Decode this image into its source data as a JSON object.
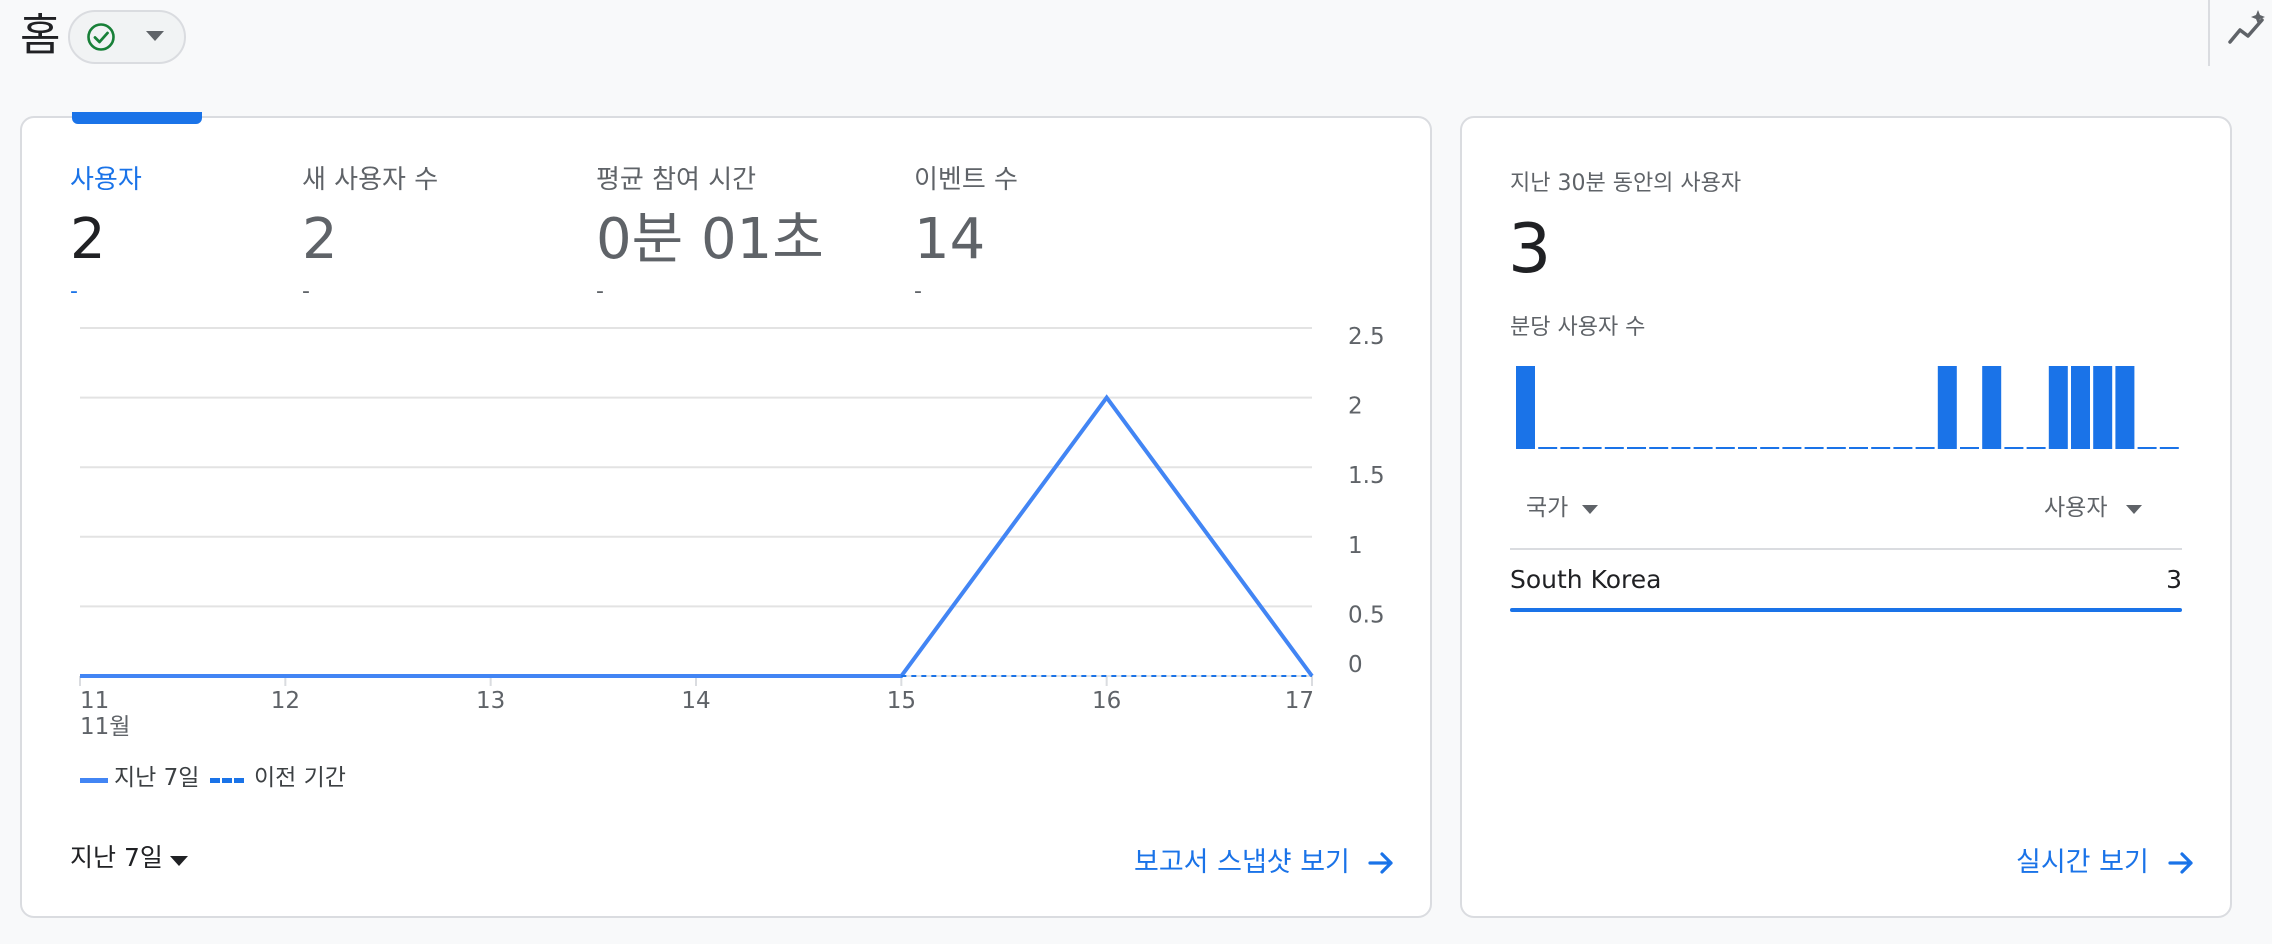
{
  "header": {
    "title": "홈",
    "status_icon": "check-circle-icon",
    "right_icon": "insights-icon"
  },
  "colors": {
    "accent": "#1a73e8",
    "line": "#4285f4",
    "status_green": "#188038"
  },
  "metrics": [
    {
      "label": "사용자",
      "value": "2",
      "delta": "-",
      "active": true
    },
    {
      "label": "새 사용자 수",
      "value": "2",
      "delta": "-",
      "active": false
    },
    {
      "label": "평균 참여 시간",
      "value": "0분 01초",
      "delta": "-",
      "active": false
    },
    {
      "label": "이벤트 수",
      "value": "14",
      "delta": "-",
      "active": false
    }
  ],
  "chart_data": {
    "type": "line",
    "x": [
      "11",
      "12",
      "13",
      "14",
      "15",
      "16",
      "17"
    ],
    "x_sublabel": "11월",
    "ylim": [
      0,
      2.5
    ],
    "y_ticks": [
      "2.5",
      "2",
      "1.5",
      "1",
      "0.5",
      "0"
    ],
    "grid": true,
    "series": [
      {
        "name": "지난 7일",
        "style": "solid",
        "values": [
          0,
          0,
          0,
          0,
          0,
          2,
          0
        ]
      },
      {
        "name": "이전 기간",
        "style": "dashed",
        "values": [
          null,
          null,
          null,
          null,
          0,
          0,
          0
        ]
      }
    ],
    "legend_position": "bottom-left"
  },
  "legend": {
    "current": "지난 7일",
    "previous": "이전 기간"
  },
  "footer": {
    "date_range": "지난 7일",
    "snapshot_link": "보고서 스냅샷 보기"
  },
  "realtime": {
    "title": "지난 30분 동안의 사용자",
    "value": "3",
    "per_minute_label": "분당 사용자 수",
    "per_minute_values": [
      1,
      0,
      0,
      0,
      0,
      0,
      0,
      0,
      0,
      0,
      0,
      0,
      0,
      0,
      0,
      0,
      0,
      0,
      0,
      1,
      0,
      1,
      0,
      0,
      1,
      1,
      1,
      1,
      0,
      0
    ],
    "col_country": "국가",
    "col_users": "사용자",
    "rows": [
      {
        "country": "South Korea",
        "users": "3",
        "share": 1.0
      }
    ],
    "link": "실시간 보기"
  }
}
